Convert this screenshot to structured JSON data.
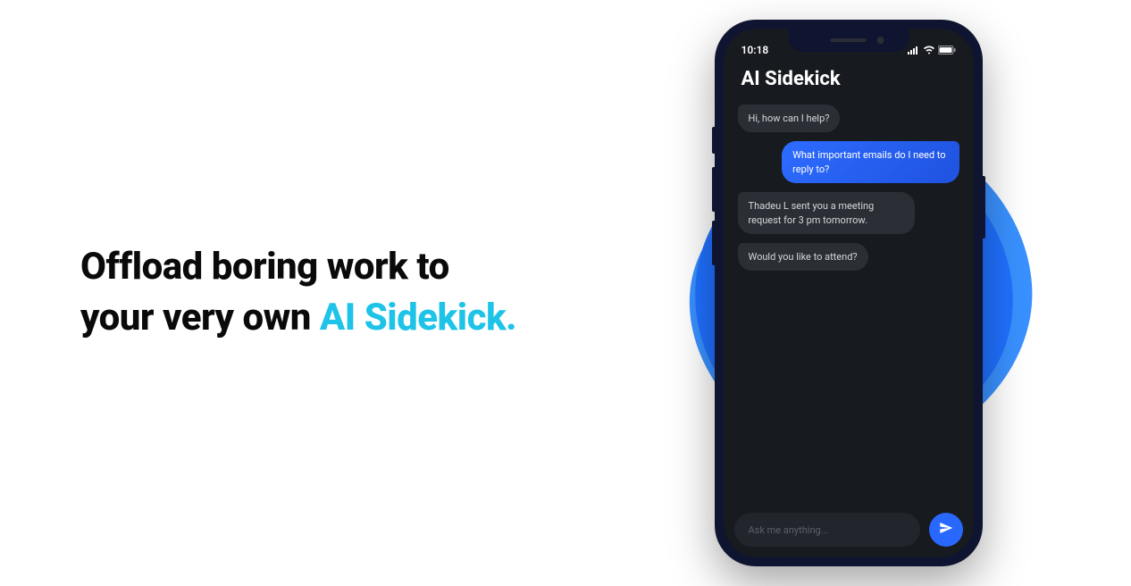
{
  "hero": {
    "headline_part1": "Offload boring work to your very own ",
    "headline_accent": "AI Sidekick."
  },
  "phone": {
    "status_time": "10:18",
    "app_title": "AI Sidekick",
    "messages": [
      {
        "role": "ai",
        "text": "Hi, how can I help?"
      },
      {
        "role": "user",
        "text": "What important emails do I need to reply to?"
      },
      {
        "role": "ai",
        "text": "Thadeu L sent you a meeting request for 3 pm tomorrow."
      },
      {
        "role": "ai",
        "text": "Would you like to attend?"
      }
    ],
    "input_placeholder": "Ask me anything..."
  }
}
